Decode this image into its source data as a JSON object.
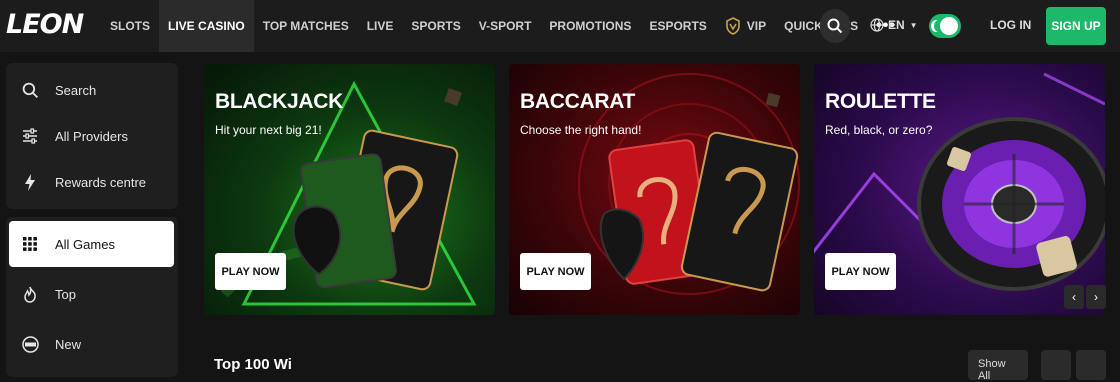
{
  "brand": {
    "logo": "LEON"
  },
  "nav": {
    "items": [
      {
        "label": "SLOTS"
      },
      {
        "label": "LIVE CASINO",
        "active": true
      },
      {
        "label": "TOP MATCHES"
      },
      {
        "label": "LIVE"
      },
      {
        "label": "SPORTS"
      },
      {
        "label": "V-SPORT"
      },
      {
        "label": "PROMOTIONS"
      },
      {
        "label": "ESPORTS"
      },
      {
        "label": "VIP",
        "icon": "crown-shield-icon"
      },
      {
        "label": "QUICK BETS"
      }
    ],
    "more_icon": "more-dots-icon"
  },
  "header": {
    "search_icon": "search-icon",
    "language": "EN",
    "theme_toggle_icon": "moon-icon",
    "login_label": "LOG IN",
    "signup_label": "SIGN UP"
  },
  "sidebar": {
    "top": [
      {
        "label": "Search",
        "icon": "search-icon"
      },
      {
        "label": "All Providers",
        "icon": "sliders-icon"
      },
      {
        "label": "Rewards centre",
        "icon": "lightning-icon"
      }
    ],
    "categories": [
      {
        "label": "All Games",
        "icon": "grid-icon",
        "selected": true
      },
      {
        "label": "Top",
        "icon": "fire-icon"
      },
      {
        "label": "New",
        "icon": "new-badge-icon"
      }
    ]
  },
  "banners": [
    {
      "title": "BLACKJACK",
      "subtitle": "Hit your next big 21!",
      "button": "PLAY NOW",
      "accent": "#2fd94a"
    },
    {
      "title": "BACCARAT",
      "subtitle": "Choose the right hand!",
      "button": "PLAY NOW",
      "accent": "#e0202c"
    },
    {
      "title": "ROULETTE",
      "subtitle": "Red, black, or zero?",
      "button": "PLAY NOW",
      "accent": "#9a38ff"
    }
  ],
  "carousel": {
    "prev_icon": "chevron-left-icon",
    "next_icon": "chevron-right-icon",
    "prev_label": "‹",
    "next_label": "›"
  },
  "section": {
    "title": "Top 100 Wi",
    "show_all": "Show All"
  },
  "colors": {
    "accent_green": "#1db86a",
    "background": "#141414"
  }
}
